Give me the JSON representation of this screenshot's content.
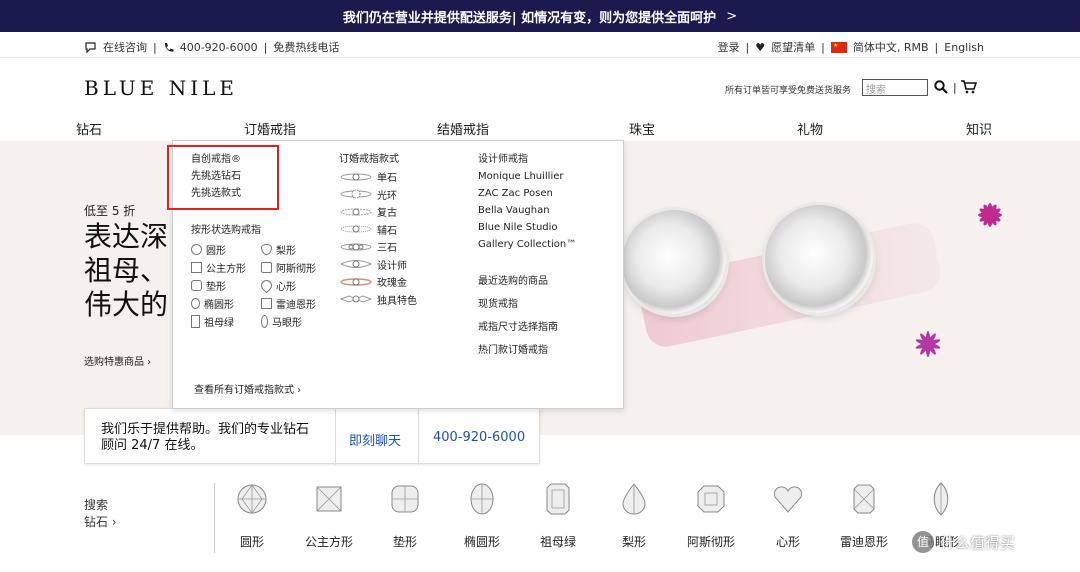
{
  "banner": {
    "text": "我们仍在营业并提供配送服务| 如情况有变，则为您提供全面呵护",
    "chevron": ">"
  },
  "utility": {
    "chat": "在线咨询",
    "phone": "400-920-6000",
    "hotline": "免费热线电话",
    "login": "登录",
    "wishlist": "愿望清单",
    "region": "简体中文, RMB",
    "english": "English"
  },
  "header": {
    "logo": "BLUE NILE",
    "ship_note": "所有订单皆可享受免费送货服务",
    "search_placeholder": "搜索"
  },
  "nav": [
    "钻石",
    "订婚戒指",
    "结婚戒指",
    "珠宝",
    "礼物",
    "知识"
  ],
  "dropdown": {
    "col1_top": [
      "自创戒指®",
      "先挑选钻石",
      "先挑选款式"
    ],
    "shape_heading": "按形状选购戒指",
    "shapes": [
      [
        "圆形",
        "梨形"
      ],
      [
        "公主方形",
        "阿斯彻形"
      ],
      [
        "垫形",
        "心形"
      ],
      [
        "椭圆形",
        "雷迪恩形"
      ],
      [
        "祖母绿",
        "马眼形"
      ]
    ],
    "view_all": "查看所有订婚戒指款式",
    "col2_heading": "订婚戒指款式",
    "styles": [
      "单石",
      "光环",
      "复古",
      "辅石",
      "三石",
      "设计师",
      "玫瑰金",
      "独具特色"
    ],
    "col3_heading": "设计师戒指",
    "designers": [
      "Monique Lhuillier",
      "ZAC Zac Posen",
      "Bella Vaughan",
      "Blue Nile Studio",
      "Gallery Collection™"
    ],
    "links": [
      "最近选购的商品",
      "现货戒指",
      "戒指尺寸选择指南",
      "热门款订婚戒指"
    ]
  },
  "hero": {
    "small": "低至 5 折",
    "headline": [
      "表达深",
      "祖母、",
      "伟大的"
    ],
    "link": "选购特惠商品"
  },
  "help": {
    "text": "我们乐于提供帮助。我们的专业钻石顾问 24/7 在线。",
    "chat": "即刻聊天",
    "phone": "400-920-6000"
  },
  "strip": {
    "search": "搜索",
    "diamond": "钻石",
    "shapes": [
      "圆形",
      "公主方形",
      "垫形",
      "椭圆形",
      "祖母绿",
      "梨形",
      "阿斯彻形",
      "心形",
      "雷迪恩形",
      "马眼形"
    ]
  },
  "watermark": "什么值得买",
  "colors": {
    "banner": "#1a1a4f",
    "link": "#1f4fb5",
    "highlight": "#e02020",
    "flower_pink": "#c02a8f",
    "flower_purple": "#b03aa8"
  }
}
